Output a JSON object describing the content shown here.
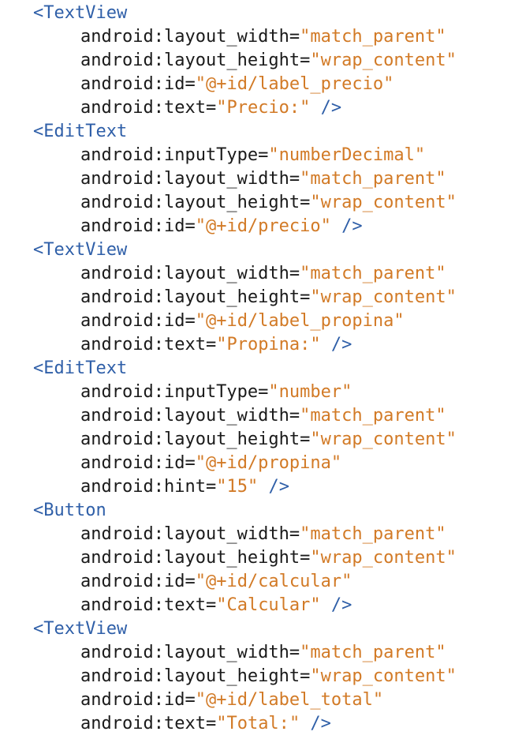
{
  "colors": {
    "tag": "#2f5fa8",
    "attribute": "#1a1a1a",
    "value": "#d27a26",
    "background": "#ffffff"
  },
  "elements": [
    {
      "tag": "TextView",
      "attrs": [
        {
          "name": "android:layout_width",
          "value": "match_parent"
        },
        {
          "name": "android:layout_height",
          "value": "wrap_content"
        },
        {
          "name": "android:id",
          "value": "@+id/label_precio"
        },
        {
          "name": "android:text",
          "value": "Precio:"
        }
      ]
    },
    {
      "tag": "EditText",
      "attrs": [
        {
          "name": "android:inputType",
          "value": "numberDecimal"
        },
        {
          "name": "android:layout_width",
          "value": "match_parent"
        },
        {
          "name": "android:layout_height",
          "value": "wrap_content"
        },
        {
          "name": "android:id",
          "value": "@+id/precio"
        }
      ]
    },
    {
      "tag": "TextView",
      "attrs": [
        {
          "name": "android:layout_width",
          "value": "match_parent"
        },
        {
          "name": "android:layout_height",
          "value": "wrap_content"
        },
        {
          "name": "android:id",
          "value": "@+id/label_propina"
        },
        {
          "name": "android:text",
          "value": "Propina:"
        }
      ]
    },
    {
      "tag": "EditText",
      "attrs": [
        {
          "name": "android:inputType",
          "value": "number"
        },
        {
          "name": "android:layout_width",
          "value": "match_parent"
        },
        {
          "name": "android:layout_height",
          "value": "wrap_content"
        },
        {
          "name": "android:id",
          "value": "@+id/propina"
        },
        {
          "name": "android:hint",
          "value": "15"
        }
      ]
    },
    {
      "tag": "Button",
      "attrs": [
        {
          "name": "android:layout_width",
          "value": "match_parent"
        },
        {
          "name": "android:layout_height",
          "value": "wrap_content"
        },
        {
          "name": "android:id",
          "value": "@+id/calcular"
        },
        {
          "name": "android:text",
          "value": "Calcular"
        }
      ]
    },
    {
      "tag": "TextView",
      "attrs": [
        {
          "name": "android:layout_width",
          "value": "match_parent"
        },
        {
          "name": "android:layout_height",
          "value": "wrap_content"
        },
        {
          "name": "android:id",
          "value": "@+id/label_total"
        },
        {
          "name": "android:text",
          "value": "Total:"
        }
      ]
    }
  ]
}
